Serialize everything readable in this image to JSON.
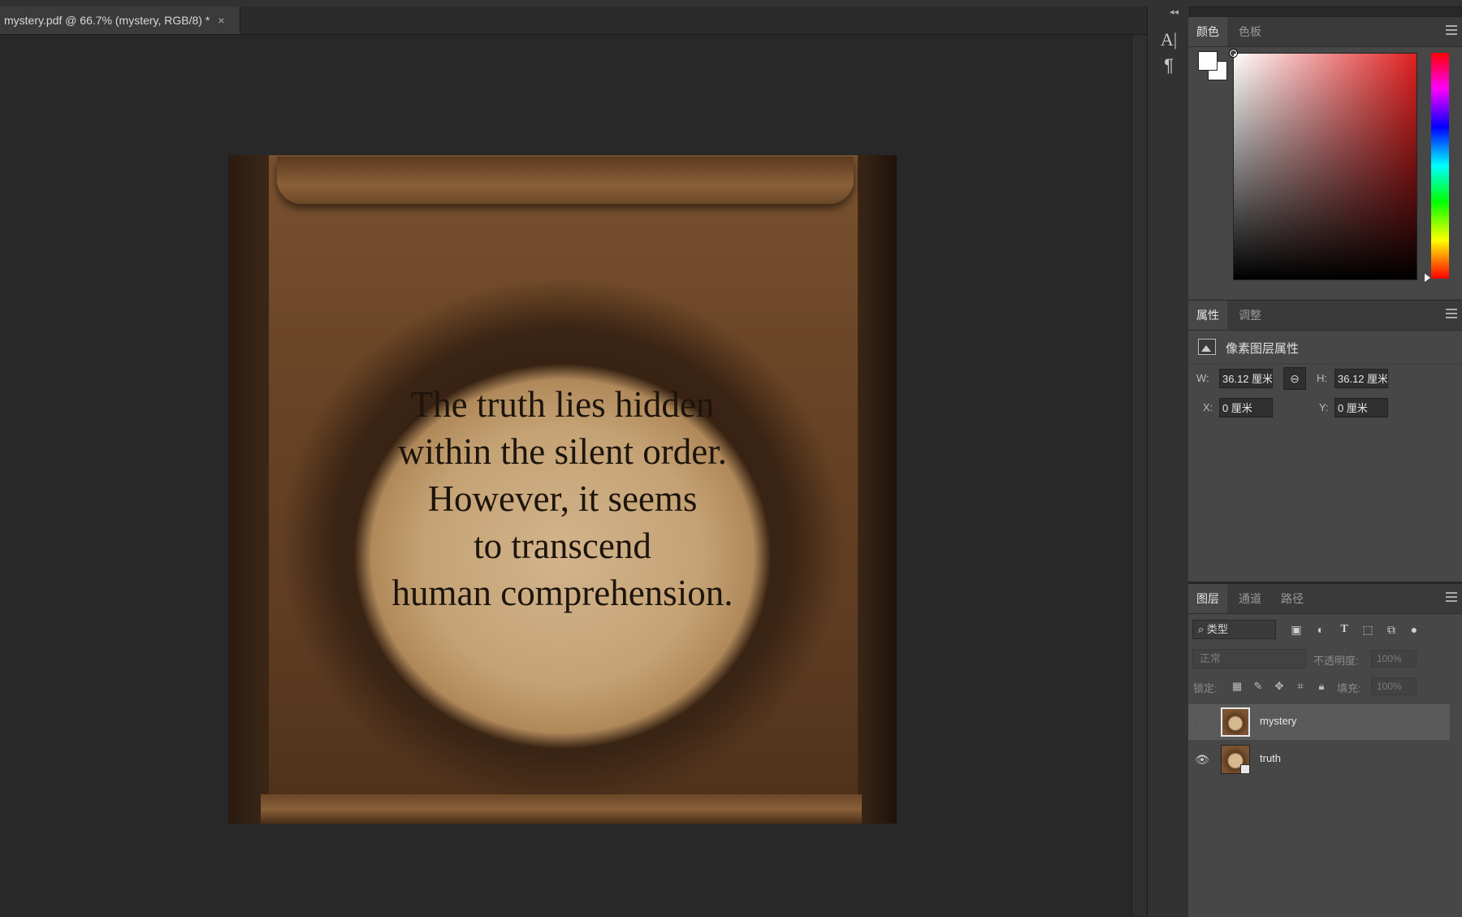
{
  "document_tab": {
    "title": "mystery.pdf @ 66.7% (mystery, RGB/8) *",
    "close_icon": "×"
  },
  "artwork": {
    "lines": [
      "The truth lies hidden",
      "within the silent order.",
      "However, it seems",
      "to transcend",
      "human comprehension."
    ]
  },
  "toolstrip": {
    "collapse": "◂◂",
    "character_glyph": "A|",
    "paragraph_glyph": "¶"
  },
  "color_panel": {
    "tabs": [
      "颜色",
      "色板"
    ],
    "active_tab": 0,
    "foreground": "#ffffff",
    "background": "#ffffff",
    "hue": "#e02020"
  },
  "properties_panel": {
    "tabs": [
      "属性",
      "调整"
    ],
    "title": "像素图层属性",
    "w_label": "W:",
    "w_value": "36.12 厘米",
    "h_label": "H:",
    "h_value": "36.12 厘米",
    "x_label": "X:",
    "x_value": "0 厘米",
    "y_label": "Y:",
    "y_value": "0 厘米",
    "link_icon": "⊖"
  },
  "layers_panel": {
    "tabs": [
      "图层",
      "通道",
      "路径"
    ],
    "filter_label": "类型",
    "blend_mode": "正常",
    "opacity_label": "不透明度:",
    "opacity_value": "100%",
    "lock_label": "锁定:",
    "fill_label": "填充:",
    "fill_value": "100%",
    "layers": [
      {
        "name": "mystery",
        "visible": false,
        "selected": true
      },
      {
        "name": "truth",
        "visible": true,
        "selected": false
      }
    ]
  }
}
